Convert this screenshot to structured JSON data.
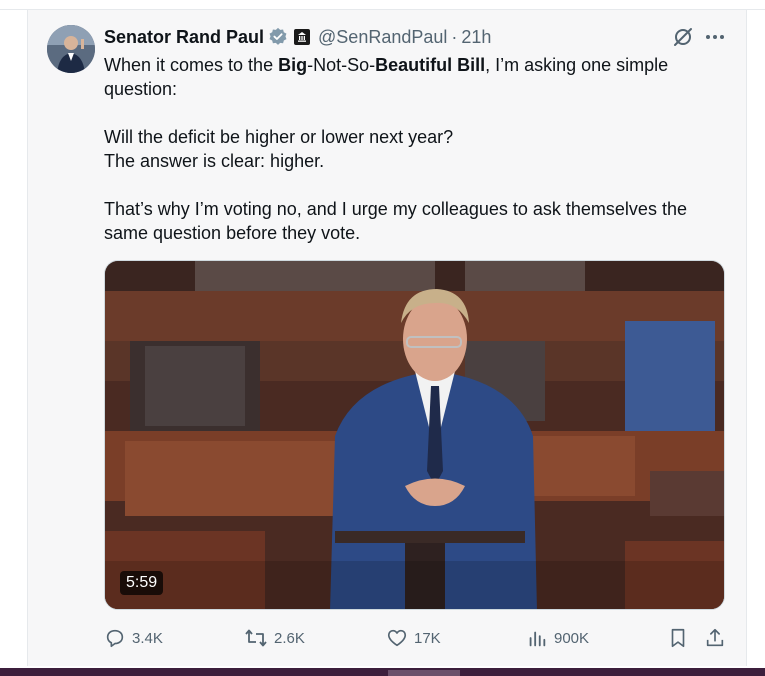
{
  "tweet": {
    "author_name": "Senator Rand Paul",
    "handle": "@SenRandPaul",
    "separator": "·",
    "time": "21h",
    "text": {
      "line1_pre": "When it comes to the ",
      "line1_bold1": "Big",
      "line1_mid": "-Not-So-",
      "line1_bold2": "Beautiful Bill",
      "line1_post": ", I’m asking one simple question:",
      "line2": "Will the deficit be higher or lower next year?",
      "line3": "The answer is clear: higher.",
      "line4": "That’s why I’m voting no, and I urge my colleagues to ask themselves the same question before they vote."
    },
    "media": {
      "duration": "5:59"
    },
    "actions": {
      "replies": "3.4K",
      "reposts": "2.6K",
      "likes": "17K",
      "views": "900K"
    }
  },
  "icons": {
    "verified": "verified-badge-icon",
    "government": "government-badge-icon",
    "grok": "grok-icon",
    "more": "more-icon",
    "reply": "reply-icon",
    "repost": "repost-icon",
    "like": "like-icon",
    "views": "views-icon",
    "bookmark": "bookmark-icon",
    "share": "share-icon"
  },
  "colors": {
    "verified": "#829aab",
    "text": "#0f1419",
    "secondary": "#536471"
  }
}
